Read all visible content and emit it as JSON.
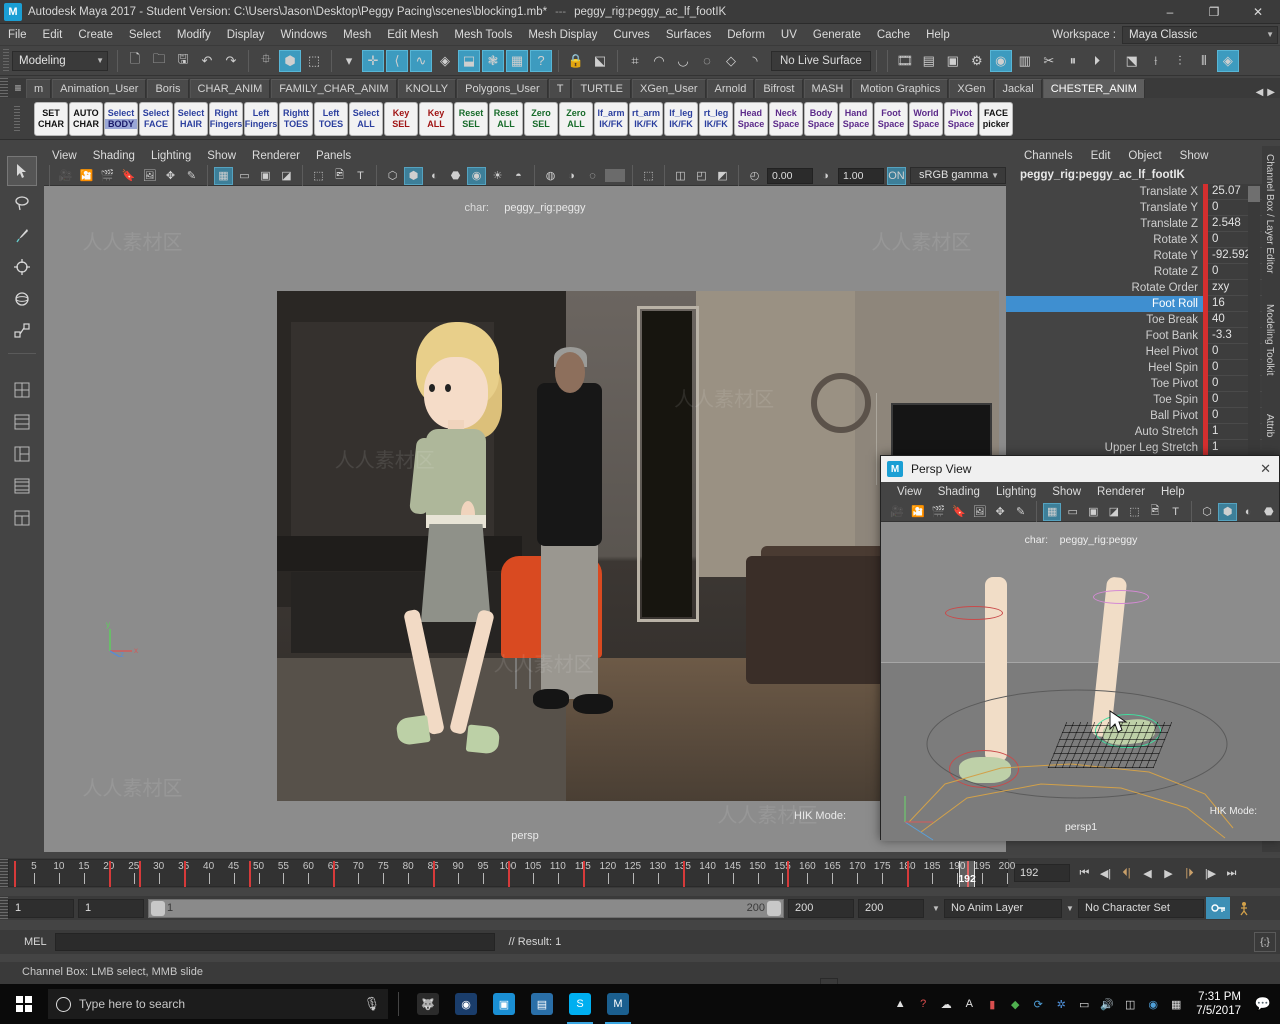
{
  "titlebar": {
    "logo": "M",
    "title": "Autodesk Maya 2017 - Student Version: C:\\Users\\Jason\\Desktop\\Peggy Pacing\\scenes\\blocking1.mb*",
    "separator": "---",
    "selection": "peggy_rig:peggy_ac_lf_footIK",
    "minimize": "–",
    "maximize": "❐",
    "close": "✕"
  },
  "menubar": {
    "items": [
      "File",
      "Edit",
      "Create",
      "Select",
      "Modify",
      "Display",
      "Windows",
      "Mesh",
      "Edit Mesh",
      "Mesh Tools",
      "Mesh Display",
      "Curves",
      "Surfaces",
      "Deform",
      "UV",
      "Generate",
      "Cache",
      "Help"
    ],
    "workspace_label": "Workspace :",
    "workspace_value": "Maya Classic"
  },
  "statusbar": {
    "mode": "Modeling",
    "live_surface": "No Live Surface"
  },
  "shelf_tabs": {
    "items": [
      "m",
      "Animation_User",
      "Boris",
      "CHAR_ANIM",
      "FAMILY_CHAR_ANIM",
      "KNOLLY",
      "Polygons_User",
      "T",
      "TURTLE",
      "XGen_User",
      "Arnold",
      "Bifrost",
      "MASH",
      "Motion Graphics",
      "XGen",
      "Jackal",
      "CHESTER_ANIM"
    ],
    "active": "CHESTER_ANIM"
  },
  "shelf_buttons": [
    {
      "l1": "SET",
      "l2": "CHAR",
      "c1": "c-blk",
      "c2": "c-blk"
    },
    {
      "l1": "AUTO",
      "l2": "CHAR",
      "c1": "c-blk",
      "c2": "c-blk"
    },
    {
      "l1": "Select",
      "l2": "BODY",
      "c1": "c-blue",
      "c2": "c-blue",
      "hl": true
    },
    {
      "l1": "Select",
      "l2": "FACE",
      "c1": "c-blue",
      "c2": "c-blue"
    },
    {
      "l1": "Select",
      "l2": "HAIR",
      "c1": "c-blue",
      "c2": "c-blue"
    },
    {
      "l1": "Right",
      "l2": "Fingers",
      "c1": "c-blue",
      "c2": "c-blue"
    },
    {
      "l1": "Left",
      "l2": "Fingers",
      "c1": "c-blue",
      "c2": "c-blue"
    },
    {
      "l1": "Rightt",
      "l2": "TOES",
      "c1": "c-blue",
      "c2": "c-blue"
    },
    {
      "l1": "Left",
      "l2": "TOES",
      "c1": "c-blue",
      "c2": "c-blue"
    },
    {
      "l1": "Select",
      "l2": "ALL",
      "c1": "c-blue",
      "c2": "c-blue"
    },
    {
      "l1": "Key",
      "l2": "SEL",
      "c1": "c-red",
      "c2": "c-red"
    },
    {
      "l1": "Key",
      "l2": "ALL",
      "c1": "c-red",
      "c2": "c-red"
    },
    {
      "l1": "Reset",
      "l2": "SEL",
      "c1": "c-green",
      "c2": "c-green"
    },
    {
      "l1": "Reset",
      "l2": "ALL",
      "c1": "c-green",
      "c2": "c-green"
    },
    {
      "l1": "Zero",
      "l2": "SEL",
      "c1": "c-green",
      "c2": "c-green"
    },
    {
      "l1": "Zero",
      "l2": "ALL",
      "c1": "c-green",
      "c2": "c-green"
    },
    {
      "l1": "lf_arm",
      "l2": "IK/FK",
      "c1": "c-blue",
      "c2": "c-blue"
    },
    {
      "l1": "rt_arm",
      "l2": "IK/FK",
      "c1": "c-blue",
      "c2": "c-blue"
    },
    {
      "l1": "lf_leg",
      "l2": "IK/FK",
      "c1": "c-blue",
      "c2": "c-blue"
    },
    {
      "l1": "rt_leg",
      "l2": "IK/FK",
      "c1": "c-blue",
      "c2": "c-blue"
    },
    {
      "l1": "Head",
      "l2": "Space",
      "c1": "c-purp",
      "c2": "c-purp"
    },
    {
      "l1": "Neck",
      "l2": "Space",
      "c1": "c-purp",
      "c2": "c-purp"
    },
    {
      "l1": "Body",
      "l2": "Space",
      "c1": "c-purp",
      "c2": "c-purp"
    },
    {
      "l1": "Hand",
      "l2": "Space",
      "c1": "c-purp",
      "c2": "c-purp"
    },
    {
      "l1": "Foot",
      "l2": "Space",
      "c1": "c-purp",
      "c2": "c-purp"
    },
    {
      "l1": "World",
      "l2": "Space",
      "c1": "c-purp",
      "c2": "c-purp"
    },
    {
      "l1": "Pivot",
      "l2": "Space",
      "c1": "c-purp",
      "c2": "c-purp"
    },
    {
      "l1": "FACE",
      "l2": "picker",
      "c1": "c-blk",
      "c2": "c-blk"
    }
  ],
  "viewport": {
    "menus": [
      "View",
      "Shading",
      "Lighting",
      "Show",
      "Renderer",
      "Panels"
    ],
    "exposure": "0.00",
    "gamma_num": "1.00",
    "color_profile": "sRGB gamma",
    "hud_char_label": "char:",
    "hud_char_value": "peggy_rig:peggy",
    "camera_label": "persp",
    "hik_label": "HIK Mode:",
    "axis_y": "y",
    "axis_x": "x",
    "axis_z": "z"
  },
  "channelbox": {
    "menus": [
      "Channels",
      "Edit",
      "Object",
      "Show"
    ],
    "node": "peggy_rig:peggy_ac_lf_footIK",
    "rows": [
      {
        "name": "Translate X",
        "value": "25.07"
      },
      {
        "name": "Translate Y",
        "value": "0"
      },
      {
        "name": "Translate Z",
        "value": "2.548"
      },
      {
        "name": "Rotate X",
        "value": "0"
      },
      {
        "name": "Rotate Y",
        "value": "-92.592"
      },
      {
        "name": "Rotate Z",
        "value": "0"
      },
      {
        "name": "Rotate Order",
        "value": "zxy"
      },
      {
        "name": "Foot Roll",
        "value": "16",
        "selected": true
      },
      {
        "name": "Toe Break",
        "value": "40"
      },
      {
        "name": "Foot Bank",
        "value": "-3.3"
      },
      {
        "name": "Heel Pivot",
        "value": "0"
      },
      {
        "name": "Heel Spin",
        "value": "0"
      },
      {
        "name": "Toe Pivot",
        "value": "0"
      },
      {
        "name": "Toe Spin",
        "value": "0"
      },
      {
        "name": "Ball Pivot",
        "value": "0"
      },
      {
        "name": "Auto Stretch",
        "value": "1"
      },
      {
        "name": "Upper Leg Stretch",
        "value": "1"
      }
    ]
  },
  "right_dock": {
    "tabs": [
      "Channel Box / Layer Editor",
      "Modeling Toolkit",
      "Attrib"
    ]
  },
  "persp_window": {
    "logo": "M",
    "title": "Persp View",
    "close": "✕",
    "menus": [
      "View",
      "Shading",
      "Lighting",
      "Show",
      "Renderer",
      "Help"
    ],
    "hud_char_label": "char:",
    "hud_char_value": "peggy_rig:peggy",
    "camera_label": "persp1",
    "hik_label": "HIK Mode:"
  },
  "timeline": {
    "labels": [
      "5",
      "10",
      "15",
      "20",
      "25",
      "30",
      "35",
      "40",
      "45",
      "50",
      "55",
      "60",
      "65",
      "70",
      "75",
      "80",
      "85",
      "90",
      "95",
      "100",
      "105",
      "110",
      "115",
      "120",
      "125",
      "130",
      "135",
      "140",
      "145",
      "150",
      "155",
      "160",
      "165",
      "170",
      "175",
      "180",
      "185",
      "190",
      "195",
      "200"
    ],
    "keyframes": [
      1,
      20,
      26,
      35,
      48,
      65,
      85,
      100,
      115,
      135,
      156,
      180,
      192
    ],
    "current_frame": "192",
    "current_field": "192"
  },
  "playback": {
    "go_start": "⏮",
    "prev_key": "⏴|",
    "step_back": "◀|",
    "play_back": "◀",
    "play_fwd": "▶",
    "step_fwd": "|▶",
    "next_key": "|⏵",
    "go_end": "⏭"
  },
  "range": {
    "start_field": "1",
    "anim_start_field": "1",
    "slider_left": "1",
    "slider_right": "200",
    "anim_end_field": "200",
    "end_field": "200",
    "anim_layer": "No Anim Layer",
    "character_set": "No Character Set"
  },
  "commandline": {
    "language": "MEL",
    "input_value": "",
    "result": "// Result: 1"
  },
  "helpline": {
    "text": "Channel Box: LMB select, MMB slide"
  },
  "taskbar": {
    "search_placeholder": "Type here to search",
    "apps": [
      {
        "name": "gimp-icon",
        "glyph": "🐺",
        "bg": "#2b2b2b"
      },
      {
        "name": "browser-icon",
        "glyph": "◉",
        "bg": "#1a3d6b"
      },
      {
        "name": "camera-app-icon",
        "glyph": "■",
        "bg": "#1a8fd4"
      },
      {
        "name": "explorer-icon",
        "glyph": "▤",
        "bg": "#2a6fa8"
      },
      {
        "name": "skype-icon",
        "glyph": "S",
        "bg": "#00aff0"
      },
      {
        "name": "maya-icon",
        "glyph": "M",
        "bg": "#1b5f8f"
      }
    ],
    "tray": [
      "▲",
      "🔊",
      "☁",
      "A",
      "🔋",
      "📶",
      "✱"
    ],
    "time": "7:31 PM",
    "date": "7/5/2017",
    "notifications": "💬"
  }
}
